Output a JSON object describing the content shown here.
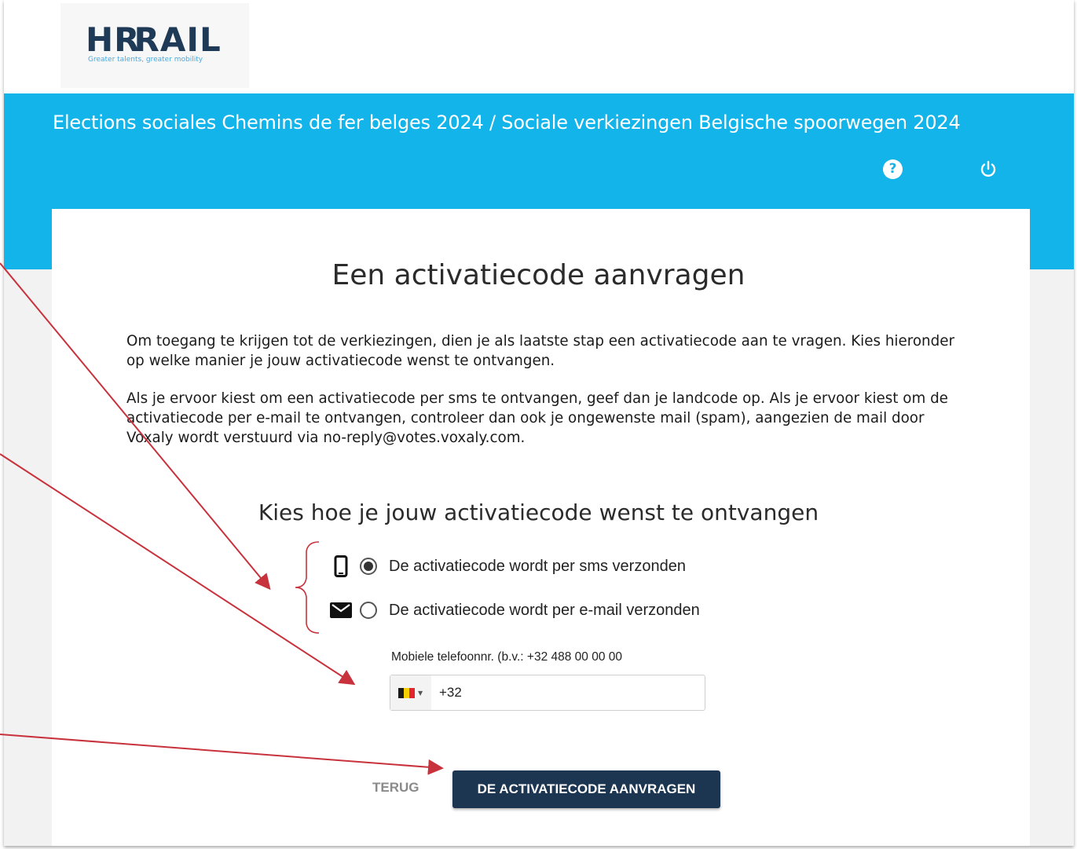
{
  "header": {
    "logo_text": "HRRAIL",
    "logo_tagline": "Greater talents, greater mobility"
  },
  "banner": {
    "title": "Elections sociales Chemins de fer belges 2024 / Sociale verkiezingen Belgische spoorwegen 2024",
    "help_glyph": "?"
  },
  "main": {
    "title": "Een activatiecode aanvragen",
    "paragraph1": "Om toegang te krijgen tot de verkiezingen, dien je als laatste stap een activatiecode aan te vragen. Kies hieronder op welke manier je jouw activatiecode wenst te ontvangen.",
    "paragraph2": "Als je ervoor kiest om een activatiecode per sms te ontvangen, geef dan je landcode op. Als je ervoor kiest om de activatiecode per e-mail te ontvangen, controleer dan ook je ongewenste mail (spam), aangezien de mail door Voxaly wordt verstuurd via no-reply@votes.voxaly.com.",
    "subtitle": "Kies hoe je jouw activatiecode wenst te ontvangen",
    "options": [
      {
        "label": "De activatiecode wordt per sms verzonden",
        "icon": "smartphone-icon",
        "selected": true
      },
      {
        "label": "De activatiecode wordt per e-mail verzonden",
        "icon": "envelope-icon",
        "selected": false
      }
    ],
    "phone": {
      "label": "Mobiele telefoonnr. (b.v.: +32 488 00 00 00",
      "value": "+32",
      "country_flag": [
        "#1a1a1a",
        "#f5d000",
        "#e0252e"
      ]
    },
    "buttons": {
      "back": "TERUG",
      "submit": "DE ACTIVATIECODE AANVRAGEN"
    }
  },
  "colors": {
    "banner": "#13b4e9",
    "submit_button": "#1c3651",
    "annotation_arrow": "#c8323c"
  }
}
